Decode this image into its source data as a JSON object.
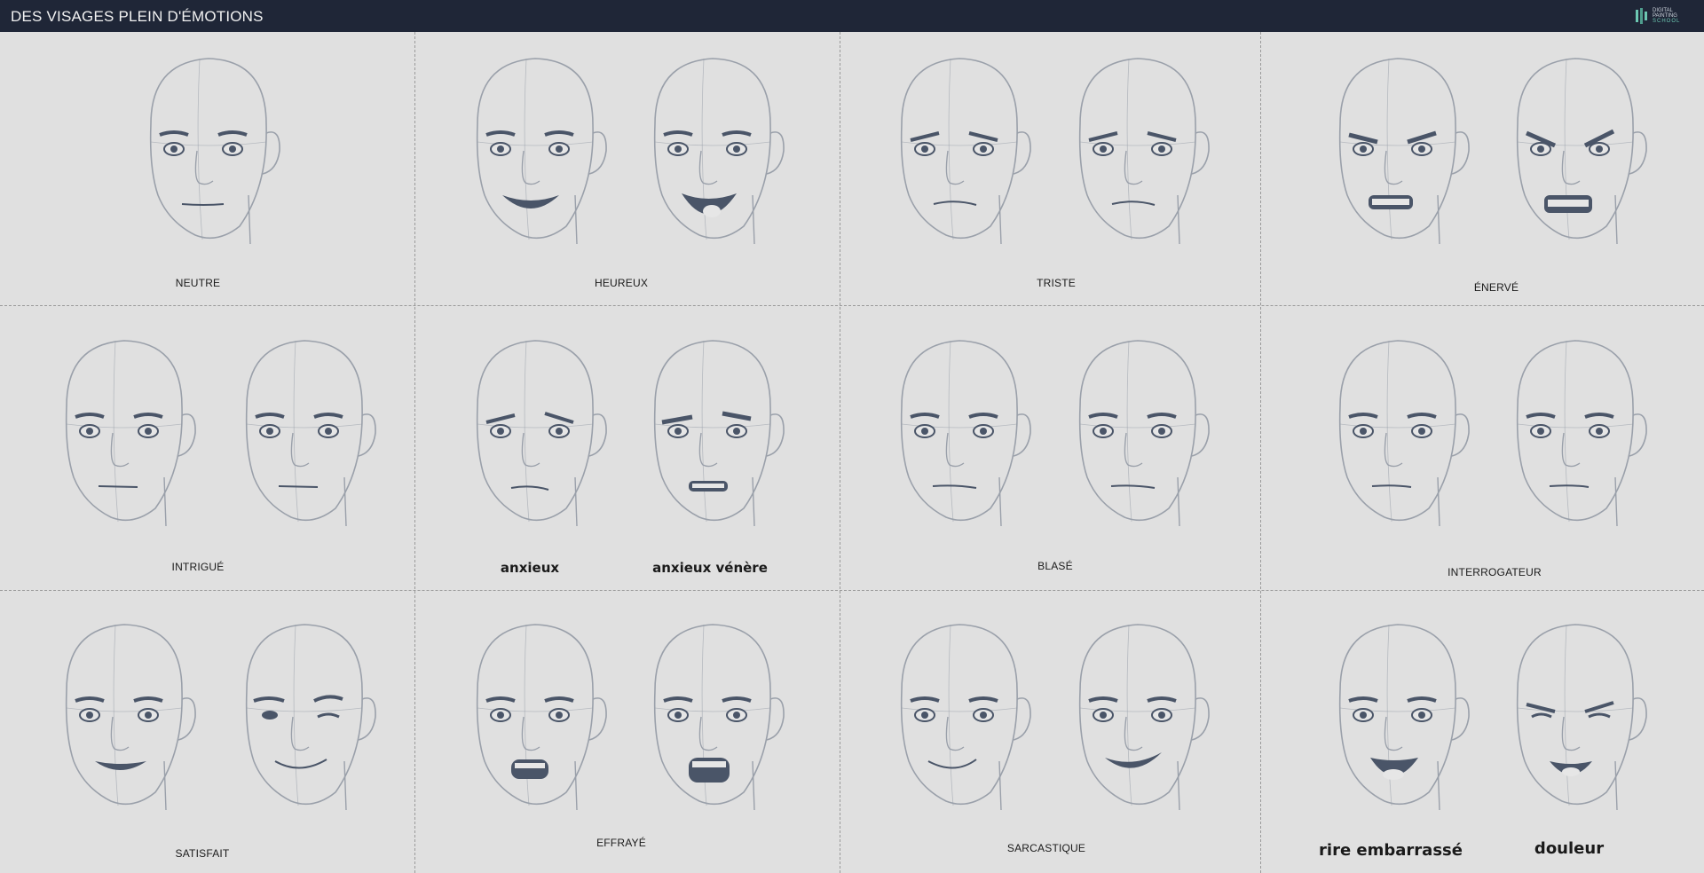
{
  "header": {
    "title": "DES VISAGES PLEIN D'ÉMOTIONS",
    "logo_line1": "DIGITAL",
    "logo_line2": "PAINTING",
    "logo_line3": "SCHOOL"
  },
  "labels": {
    "neutre": "NEUTRE",
    "heureux": "HEUREUX",
    "triste": "TRISTE",
    "enerve": "ÉNERVÉ",
    "intrigue": "INTRIGUÉ",
    "anxieux": "anxieux",
    "anxieux_venere": "anxieux vénère",
    "blase": "BLASÉ",
    "interrogateur": "INTERROGATEUR",
    "satisfait": "SATISFAIT",
    "effraye": "EFFRAYÉ",
    "sarcastique": "SARCASTIQUE",
    "rire_embarrasse": "rire embarrassé",
    "douleur": "douleur"
  },
  "colors": {
    "header_bg": "#1f2637",
    "page_bg": "#e0e0e0",
    "sketch_line": "#9aa0aa",
    "feature_fill": "#4a5568",
    "logo_accent": "#6cc7b2"
  }
}
